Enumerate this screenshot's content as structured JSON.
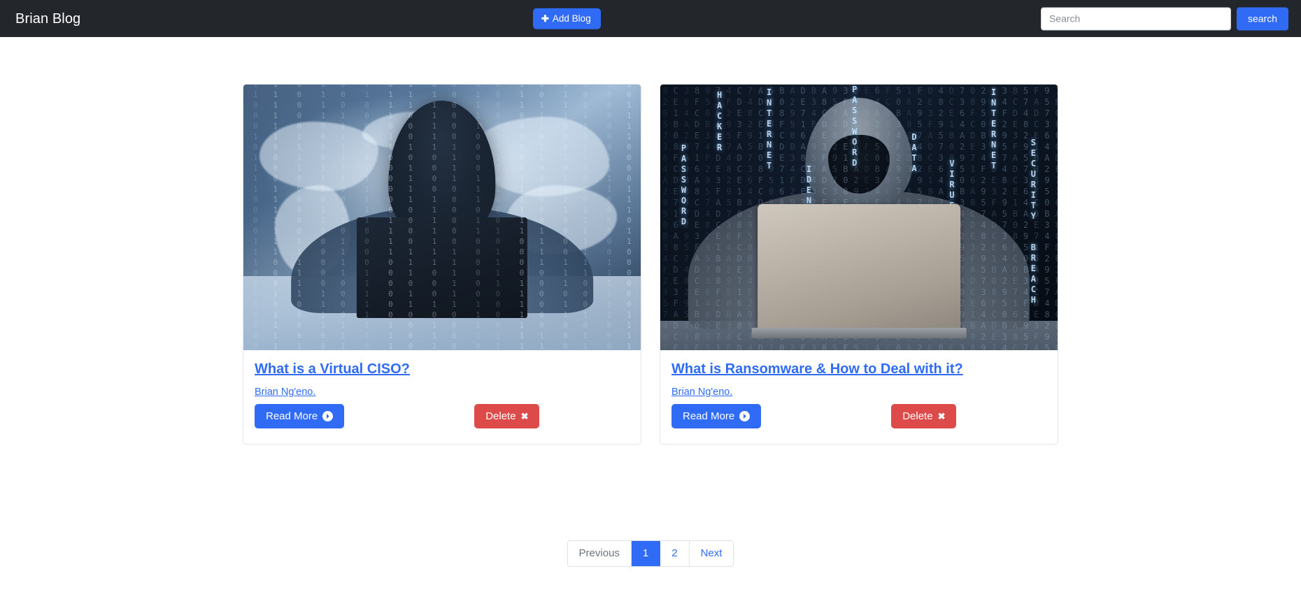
{
  "navbar": {
    "brand": "Brian Blog",
    "add_blog_label": "Add Blog",
    "add_blog_icon": "plus-icon",
    "search_placeholder": "Search",
    "search_value": "",
    "search_button_label": "search",
    "background_color": "#23272b",
    "accent_color": "#2f6bf5"
  },
  "posts": [
    {
      "title": "What is a Virtual CISO?",
      "author": "Brian Ng'eno.",
      "read_more_label": "Read More",
      "read_more_icon": "circle-arrow-right-icon",
      "delete_label": "Delete",
      "delete_icon": "close-x-icon",
      "image_alt": "Hooded hacker at laptop over world map with binary code overlay"
    },
    {
      "title": "What is Ransomware & How to Deal with it?",
      "author": "Brian Ng'eno.",
      "read_more_label": "Read More",
      "read_more_icon": "circle-arrow-right-icon",
      "delete_label": "Delete",
      "delete_icon": "close-x-icon",
      "image_alt": "Hooded hacker behind silver laptop with matrix code wall"
    }
  ],
  "pagination": {
    "previous_label": "Previous",
    "next_label": "Next",
    "pages": [
      "1",
      "2"
    ],
    "active_page": "1",
    "active_color": "#2f6bf5"
  },
  "colors": {
    "primary": "#2f6bf5",
    "danger": "#dc4a4a",
    "navbar": "#23272b",
    "page_background": "#ffffff",
    "card_border": "#e3e6e8"
  },
  "art": {
    "binary_glyphs": "1011001010110100101100101101001011010010110100101101",
    "matrix_glyphs": "4F8A2D9C5E713B6048AF2C9D5E07B1364AF82C9D5E73",
    "code_words": [
      "PASSWORD",
      "HACKER",
      "INTERNET",
      "IDENTITY THEFT",
      "PASSWORD",
      "DATA",
      "VIRUS",
      "INTERNET",
      "SECURITY BREACH"
    ]
  }
}
